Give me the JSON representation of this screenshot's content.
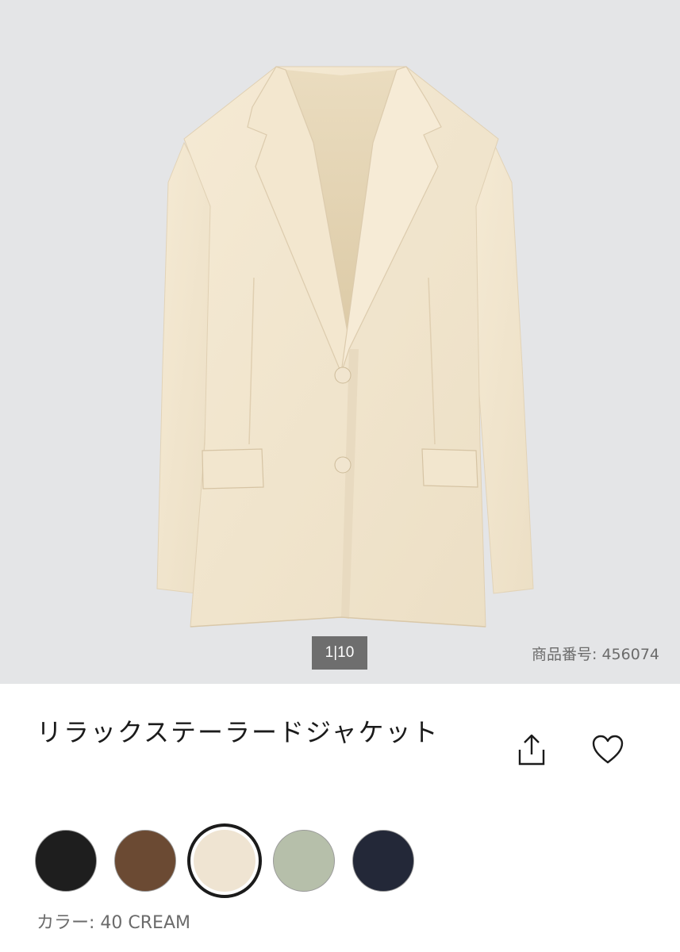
{
  "gallery": {
    "counter": "1|10",
    "product_number_label": "商品番号:",
    "product_number": "456074",
    "image_alt": "jacket-image"
  },
  "product": {
    "title": "リラックステーラードジャケット"
  },
  "actions": {
    "share_icon": "share-icon",
    "favorite_icon": "heart-icon"
  },
  "colors": {
    "swatches": [
      {
        "color": "#1e1e1e"
      },
      {
        "color": "#6b4a33"
      },
      {
        "color": "#efe4d2"
      },
      {
        "color": "#b6bfaa"
      },
      {
        "color": "#232838"
      }
    ],
    "selected_index": 2,
    "label": "カラー:",
    "value": "40 CREAM"
  }
}
